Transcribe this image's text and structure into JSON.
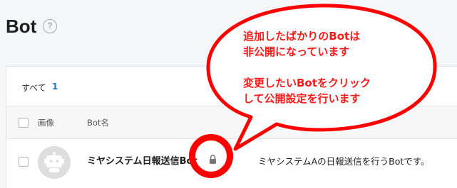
{
  "header": {
    "title": "Bot",
    "help": "?"
  },
  "filter": {
    "all_label": "すべて",
    "count": "1"
  },
  "table": {
    "columns": {
      "image": "画像",
      "name": "Bot名"
    },
    "rows": [
      {
        "name": "ミヤシステム日報送信Bot",
        "description": "ミヤシステムAの日報送信を行うBotです。"
      }
    ]
  },
  "annotation": {
    "line1": "追加したばかりのBotは",
    "line2": "非公開になっています",
    "line3": "変更したいBotをクリック",
    "line4": "して公開設定を行います"
  },
  "colors": {
    "accent": "#1a73c8",
    "annotation": "#ff0000"
  }
}
